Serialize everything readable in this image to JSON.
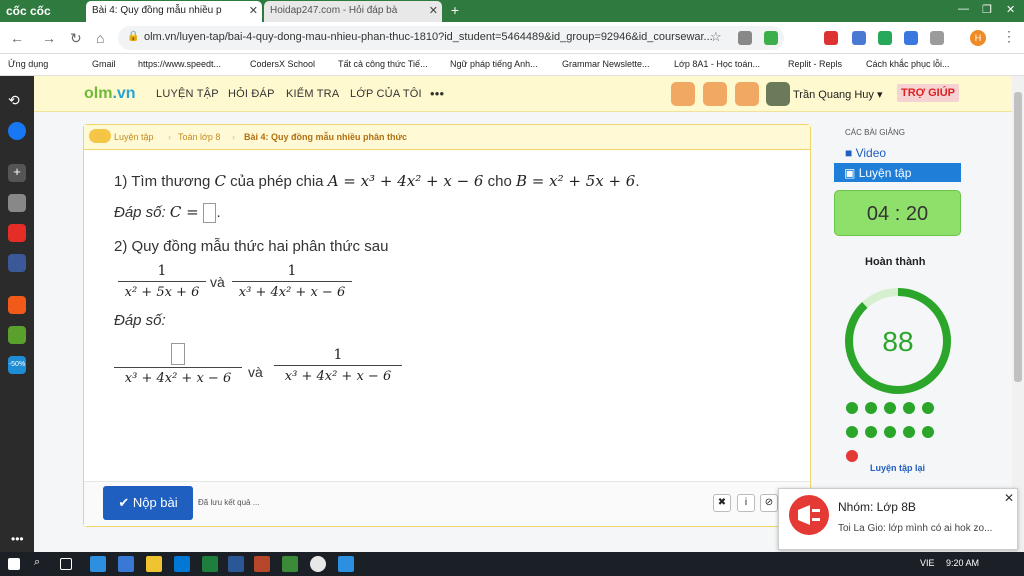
{
  "browser": {
    "brand": "cốc cốc",
    "tabs": [
      {
        "title": "Bài 4: Quy đồng mẫu nhiều p"
      },
      {
        "title": "Hoidap247.com - Hỏi đáp bà"
      }
    ],
    "new_tab": "+",
    "url": "olm.vn/luyen-tap/bai-4-quy-dong-mau-nhieu-phan-thuc-1810?id_student=5464489&id_group=92946&id_coursewar...",
    "profile_initial": "H",
    "bookmarks": [
      "Ứng dụng",
      "Gmail",
      "https://www.speedt...",
      "CodersX School",
      "Tất cả công thức Tiế...",
      "Ngữ pháp tiếng Anh...",
      "Grammar Newslette...",
      "Lớp 8A1 - Học toán...",
      "Replit - Repls",
      "Cách khắc phục lỗi..."
    ]
  },
  "rail": {
    "sale_badge": "-50%"
  },
  "site": {
    "logo_main": "olm",
    "logo_tld": ".vn",
    "menu": [
      "LUYỆN TẬP",
      "HỎI ĐÁP",
      "KIỂM TRA",
      "LỚP CỦA TÔI",
      "•••"
    ],
    "user": "Trần Quang Huy",
    "help": "TRỢ GIÚP"
  },
  "breadcrumb": [
    "Luyện tập",
    "Toán lớp 8",
    "Bài 4: Quy đồng mẫu nhiều phân thức"
  ],
  "q1": {
    "prefix": "1) Tìm thương ",
    "C": "C",
    "mid1": " của phép chia ",
    "A": "A = x³ + 4x² + x − 6",
    "mid2": " cho ",
    "B": "B = x² + 5x + 6",
    "end": ".",
    "answer_label": "Đáp số: ",
    "answer_var": "C = ",
    "answer_end": "."
  },
  "q2": {
    "title": "2) Quy đồng mẫu thức hai phân thức sau",
    "frac1": {
      "num": "1",
      "den": "x² + 5x + 6"
    },
    "and": "và",
    "frac2": {
      "num": "1",
      "den": "x³ + 4x² + x − 6"
    },
    "answer_label": "Đáp số:",
    "ans1_den": "x³ + 4x² + x − 6",
    "ans2": {
      "num": "1",
      "den": "x³ + 4x² + x − 6"
    }
  },
  "footer": {
    "submit": "✔ Nộp bài",
    "saved": "Đã lưu kết quả ...",
    "buttons": [
      "✖",
      "i",
      "⊘"
    ]
  },
  "sidebar": {
    "heading": "CÁC BÀI GIẢNG",
    "items": [
      "Video",
      "Luyện tập"
    ],
    "timer": "04 : 20",
    "done_label": "Hoàn thành",
    "score": "88",
    "score_fraction": 0.88,
    "retry": "Luyện tập lại"
  },
  "notification": {
    "title": "Nhóm: Lớp 8B",
    "body": "Toi La Gio: lớp mình có ai hok zo..."
  },
  "taskbar": {
    "lang": "VIE",
    "time": "9:20 AM"
  },
  "colors": {
    "accent": "#1f5fbf",
    "progress": "#2ba62b",
    "header": "#fff9cf"
  }
}
